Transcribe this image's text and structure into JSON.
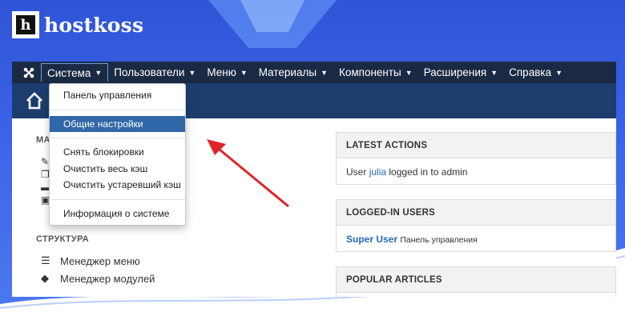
{
  "brand": {
    "logo_letter": "h",
    "name": "hostkoss"
  },
  "navbar": {
    "items": [
      {
        "label": "Система"
      },
      {
        "label": "Пользователи"
      },
      {
        "label": "Меню"
      },
      {
        "label": "Материалы"
      },
      {
        "label": "Компоненты"
      },
      {
        "label": "Расширения"
      },
      {
        "label": "Справка"
      }
    ]
  },
  "dropdown": {
    "items": [
      "Панель управления",
      "Общие настройки",
      "Снять блокировки",
      "Очистить весь кэш",
      "Очистить устаревший кэш",
      "Информация о системе"
    ]
  },
  "left": {
    "section1_partial": "МА",
    "section2": "СТРУКТУРА",
    "struct_items": [
      "Менеджер меню",
      "Менеджер модулей"
    ]
  },
  "panels": {
    "latest": {
      "title": "LATEST ACTIONS",
      "prefix": "User",
      "user": "julia",
      "suffix": "logged in to admin"
    },
    "logged": {
      "title": "LOGGED-IN USERS",
      "user": "Super User",
      "location": "Панель управления"
    },
    "popular": {
      "title": "POPULAR ARTICLES"
    }
  },
  "colors": {
    "background": "#3b63e8",
    "navbar": "#1a2a44",
    "subheader": "#1c3d6e",
    "selected": "#2f67a8",
    "link": "#2a69b8",
    "arrow": "#e0242a"
  }
}
